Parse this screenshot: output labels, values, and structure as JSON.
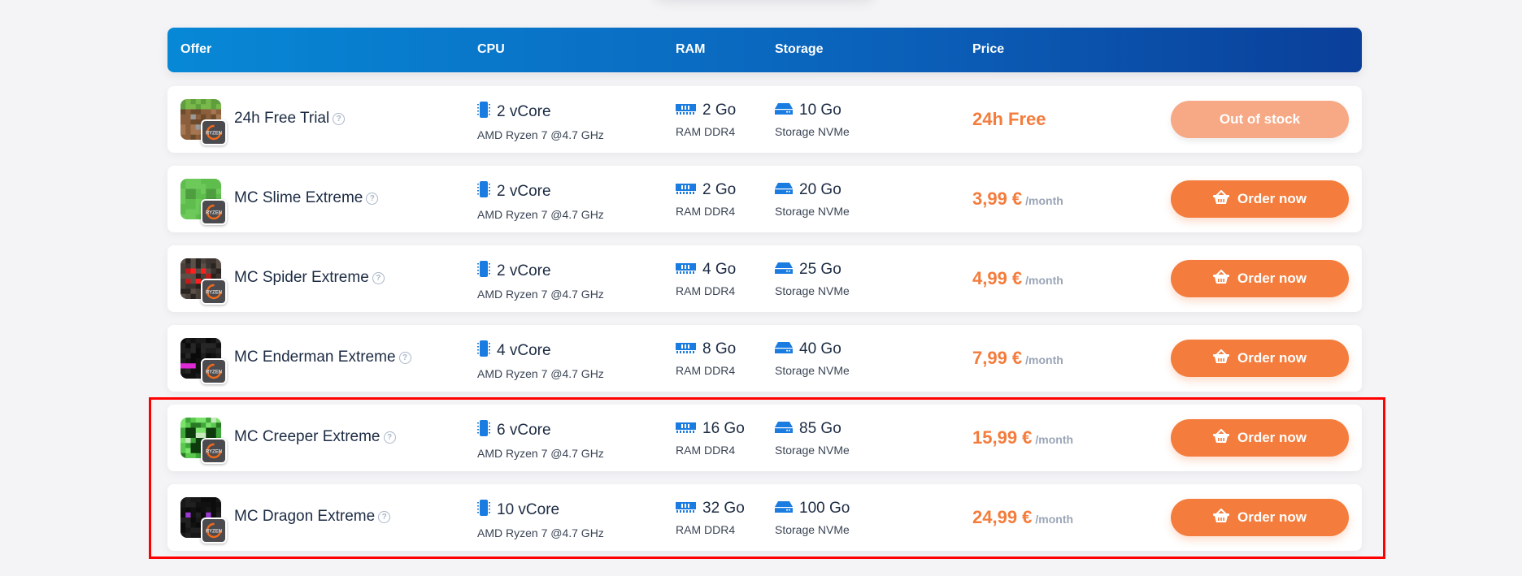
{
  "header": {
    "columns": [
      "Offer",
      "CPU",
      "RAM",
      "Storage",
      "Price"
    ]
  },
  "colors": {
    "accent_orange": "#f47c3c",
    "accent_orange_disabled": "#f7a884",
    "header_blue_start": "#0788d6",
    "header_blue_end": "#0a3f9a",
    "spec_icon_blue": "#1a7ce0",
    "highlight_red": "#ff0000"
  },
  "offers": [
    {
      "name": "24h Free Trial",
      "thumb": "grass-block",
      "cpu": "2 vCore",
      "cpu_sub": "AMD Ryzen 7 @4.7 GHz",
      "ram": "2 Go",
      "ram_sub": "RAM DDR4",
      "storage": "10 Go",
      "storage_sub": "Storage NVMe",
      "price": "24h Free",
      "period": "",
      "button": "Out of stock",
      "available": false
    },
    {
      "name": "MC Slime Extreme",
      "thumb": "slime",
      "cpu": "2 vCore",
      "cpu_sub": "AMD Ryzen 7 @4.7 GHz",
      "ram": "2 Go",
      "ram_sub": "RAM DDR4",
      "storage": "20 Go",
      "storage_sub": "Storage NVMe",
      "price": "3,99 €",
      "period": "/month",
      "button": "Order now",
      "available": true
    },
    {
      "name": "MC Spider Extreme",
      "thumb": "spider",
      "cpu": "2 vCore",
      "cpu_sub": "AMD Ryzen 7 @4.7 GHz",
      "ram": "4 Go",
      "ram_sub": "RAM DDR4",
      "storage": "25 Go",
      "storage_sub": "Storage NVMe",
      "price": "4,99 €",
      "period": "/month",
      "button": "Order now",
      "available": true
    },
    {
      "name": "MC Enderman Extreme",
      "thumb": "enderman",
      "cpu": "4 vCore",
      "cpu_sub": "AMD Ryzen 7 @4.7 GHz",
      "ram": "8 Go",
      "ram_sub": "RAM DDR4",
      "storage": "40 Go",
      "storage_sub": "Storage NVMe",
      "price": "7,99 €",
      "period": "/month",
      "button": "Order now",
      "available": true
    },
    {
      "name": "MC Creeper Extreme",
      "thumb": "creeper",
      "cpu": "6 vCore",
      "cpu_sub": "AMD Ryzen 7 @4.7 GHz",
      "ram": "16 Go",
      "ram_sub": "RAM DDR4",
      "storage": "85 Go",
      "storage_sub": "Storage NVMe",
      "price": "15,99 €",
      "period": "/month",
      "button": "Order now",
      "available": true
    },
    {
      "name": "MC Dragon Extreme",
      "thumb": "dragon",
      "cpu": "10 vCore",
      "cpu_sub": "AMD Ryzen 7 @4.7 GHz",
      "ram": "32 Go",
      "ram_sub": "RAM DDR4",
      "storage": "100 Go",
      "storage_sub": "Storage NVMe",
      "price": "24,99 €",
      "period": "/month",
      "button": "Order now",
      "available": true
    }
  ],
  "badge_label": "RYZEN",
  "help_glyph": "?"
}
